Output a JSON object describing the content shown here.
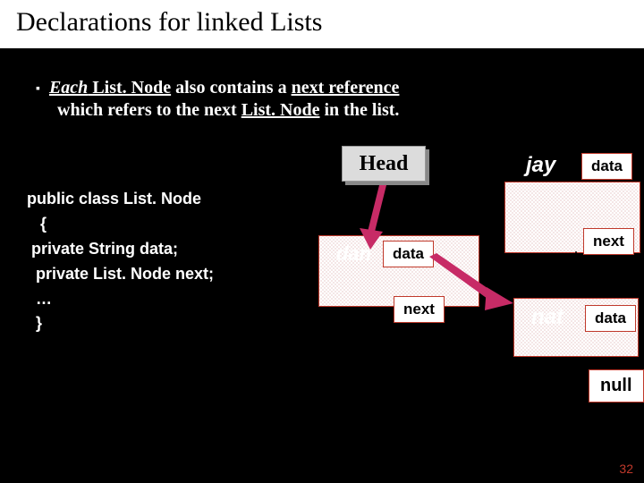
{
  "title": "Declarations for linked Lists",
  "bullet": {
    "marker": "▪",
    "line1_prefix": "Each",
    "line1_bold": " List. Node",
    "line1_mid": " also contains a ",
    "line1_ref": "next reference",
    "line2_prefix": "which refers to the next ",
    "line2_bold": "List. Node",
    "line2_suffix": " in the list."
  },
  "code": {
    "l1": "public class List. Node",
    "l2": "   {",
    "l3": " private String data;",
    "l4": "  private List. Node next;",
    "l5": "  …",
    "l6": "  }"
  },
  "diagram": {
    "head": "Head",
    "node1": {
      "value": "dan",
      "data_label": "data",
      "next_label": "next"
    },
    "node2": {
      "value": "jay",
      "data_label": "data",
      "next_label": "next"
    },
    "node3": {
      "value": "nat",
      "data_label": "data"
    },
    "null": "null"
  },
  "page_number": "32"
}
